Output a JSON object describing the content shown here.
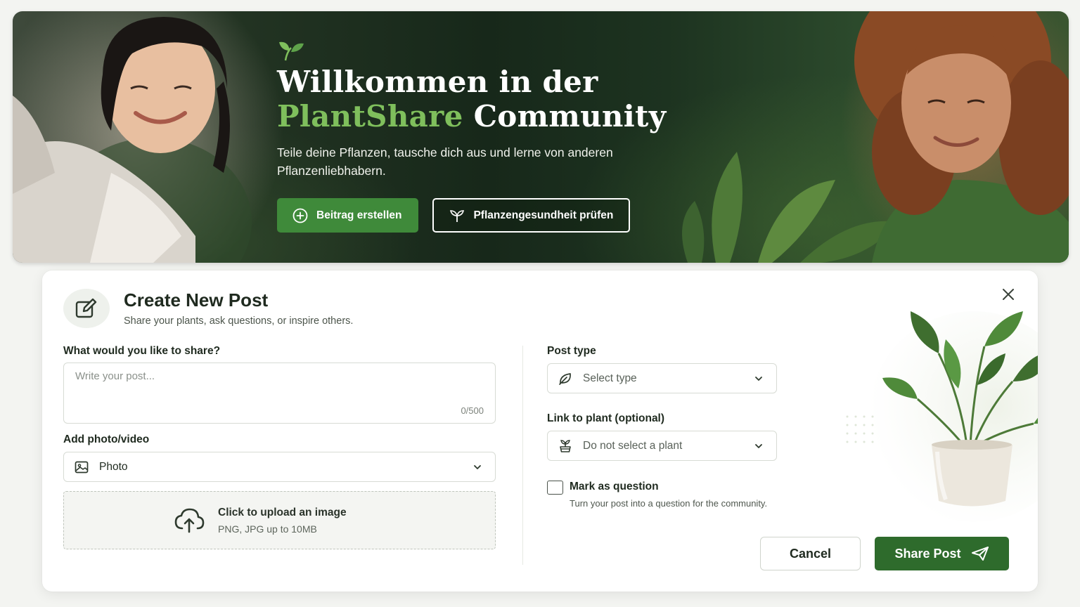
{
  "hero": {
    "title_line1": "Willkommen in der",
    "title_accent": "PlantShare",
    "title_rest": "Community",
    "subtitle": "Teile deine Pflanzen, tausche dich aus und lerne von anderen Pflanzenliebhabern.",
    "primary_button": "Beitrag erstellen",
    "secondary_button": "Pflanzengesundheit prüfen",
    "logo_icon": "sprout-icon",
    "colors": {
      "accent": "#7fbf5c",
      "primary_button": "#3f8a3a"
    }
  },
  "modal": {
    "title": "Create New Post",
    "subtitle": "Share your plants, ask questions, or inspire others.",
    "header_icon": "edit-icon",
    "close_icon": "close-icon",
    "content": {
      "label": "What would you like to share?",
      "placeholder": "Write your post...",
      "counter": "0/500"
    },
    "media": {
      "label": "Add photo/video",
      "selected": "Photo",
      "upload_title": "Click to upload an image",
      "upload_hint": "PNG, JPG up to 10MB"
    },
    "post_type": {
      "label": "Post type",
      "selected": "Select type"
    },
    "plant_link": {
      "label": "Link to plant (optional)",
      "selected": "Do not select a plant"
    },
    "question": {
      "label": "Mark as question",
      "hint": "Turn your post into a question for the community.",
      "checked": false
    },
    "actions": {
      "cancel": "Cancel",
      "share": "Share Post"
    },
    "colors": {
      "share_button": "#2e6b2c",
      "border": "#d7dbd4"
    }
  }
}
